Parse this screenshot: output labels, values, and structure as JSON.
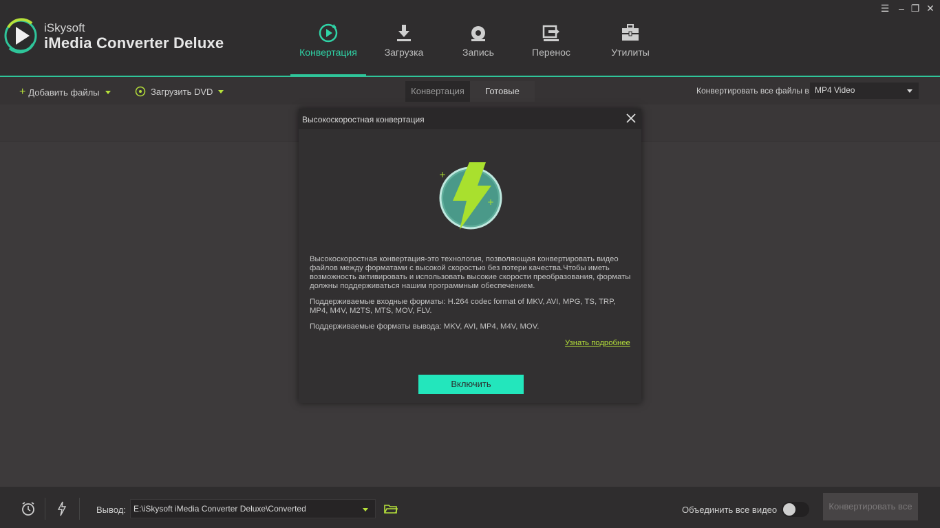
{
  "app": {
    "brand_small": "iSkysoft",
    "brand_big": "iMedia Converter Deluxe"
  },
  "nav": {
    "tabs": [
      {
        "label": "Конвертация",
        "icon": "convert-icon",
        "active": true
      },
      {
        "label": "Загрузка",
        "icon": "download-icon",
        "active": false
      },
      {
        "label": "Запись",
        "icon": "burn-disc-icon",
        "active": false
      },
      {
        "label": "Перенос",
        "icon": "transfer-icon",
        "active": false
      },
      {
        "label": "Утилиты",
        "icon": "toolbox-icon",
        "active": false
      }
    ]
  },
  "window_controls": [
    "menu-icon",
    "minimize-icon",
    "restore-icon",
    "close-icon"
  ],
  "toolbar": {
    "add_files": "Добавить файлы",
    "load_dvd": "Загрузить DVD",
    "seg_converting": "Конвертация",
    "seg_done": "Готовые",
    "convert_all_to_label": "Конвертировать все файлы в",
    "format_value": "MP4 Video"
  },
  "dialog": {
    "title": "Высокоскоростная конвертация",
    "paragraph_1": "Высокоскоростная конвертация-это технология, позволяющая конвертировать видео файлов между форматами с высокой скоростью без потери качества.Чтобы иметь возможность активировать и использовать высокие скорости преобразования, форматы должны поддерживаться нашим программным обеспечением.",
    "paragraph_2": "Поддерживаемые входные форматы: H.264 codec format of MKV, AVI, MPG, TS, TRP, MP4, M4V, M2TS, MTS, MOV, FLV.",
    "paragraph_3": "Поддерживаемые форматы вывода: MKV, AVI, MP4, M4V, MOV.",
    "learn_more": "Узнать подробнее",
    "enable_button": "Включить"
  },
  "bottom": {
    "output_label": "Вывод:",
    "output_path": "E:\\iSkysoft iMedia Converter Deluxe\\Converted",
    "merge_label": "Объединить все видео",
    "merge_enabled": false,
    "convert_all_button": "Конвертировать все"
  },
  "colors": {
    "accent": "#2fc59a",
    "lime": "#b6e13a",
    "button": "#23e6bc"
  }
}
